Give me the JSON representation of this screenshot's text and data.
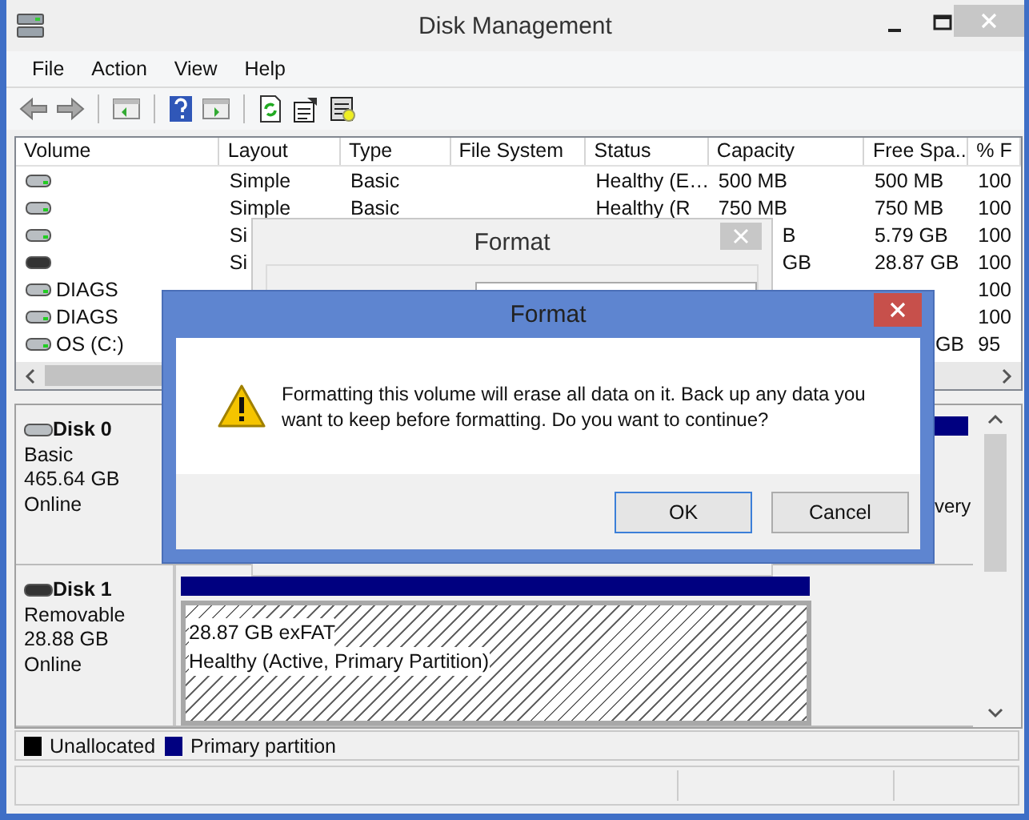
{
  "window": {
    "title": "Disk Management"
  },
  "menu": [
    "File",
    "Action",
    "View",
    "Help"
  ],
  "volumes": {
    "columns": [
      "Volume",
      "Layout",
      "Type",
      "File System",
      "Status",
      "Capacity",
      "Free Spa...",
      "% F"
    ],
    "rows": [
      {
        "kind": "hdd",
        "layout": "Simple",
        "type": "Basic",
        "status": "Healthy (E…",
        "capacity": "500 MB",
        "free_space": "500 MB",
        "percent_free": "100"
      },
      {
        "kind": "hdd",
        "layout": "Simple",
        "type": "Basic",
        "status": "Healthy (R",
        "capacity": "750 MB",
        "free_space": "750 MB",
        "percent_free": "100"
      },
      {
        "kind": "hdd",
        "layout": "Si",
        "capacity": "B",
        "free_space": "5.79 GB",
        "percent_free": "100",
        "behind_back_dialog": true
      },
      {
        "kind": "removable",
        "layout": "Si",
        "capacity": "GB",
        "free_space": "28.87 GB",
        "percent_free": "100",
        "behind_back_dialog": true
      },
      {
        "kind": "hdd",
        "volume": "DIAGS",
        "percent_free": "100"
      },
      {
        "kind": "hdd",
        "volume": "DIAGS",
        "percent_free": "100"
      },
      {
        "kind": "hdd",
        "volume": "OS (C:)",
        "free_space": "GB",
        "percent_free": "95",
        "behind_front_dialog": true
      }
    ]
  },
  "disks": [
    {
      "kind": "hdd",
      "name": "Disk 0",
      "type": "Basic",
      "size": "465.64 GB",
      "status": "Online",
      "partition_fragment": "very"
    },
    {
      "kind": "removable",
      "name": "Disk 1",
      "type": "Removable",
      "size": "28.88 GB",
      "status": "Online",
      "partition": {
        "size": "28.87 GB exFAT",
        "status": "Healthy (Active, Primary Partition)",
        "selected": true
      }
    }
  ],
  "legend": [
    {
      "label": "Unallocated",
      "color": "#000000"
    },
    {
      "label": "Primary partition",
      "color": "#000080"
    }
  ],
  "back_dialog": {
    "title": "Format"
  },
  "dialog": {
    "title": "Format",
    "message": "Formatting this volume will erase all data on it. Back up any data you want to keep before formatting. Do you want to continue?",
    "buttons": [
      {
        "label": "OK",
        "selected": true
      },
      {
        "label": "Cancel",
        "selected": false
      }
    ]
  }
}
